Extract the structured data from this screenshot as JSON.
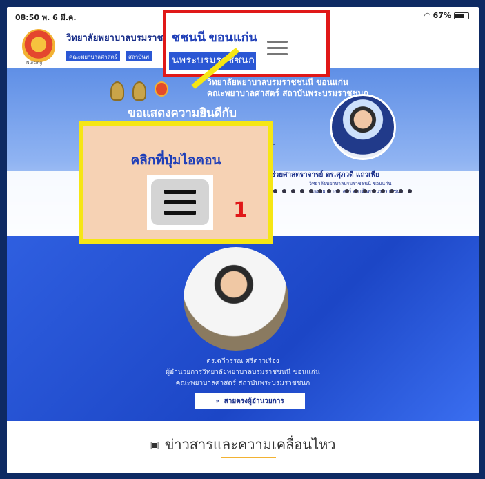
{
  "status_bar": {
    "time_date": "08:50  พ. 6 มี.ค.",
    "battery": "67%"
  },
  "header": {
    "site_title": "วิทยาลัยพยาบาลบรมราชช",
    "chip1": "คณะพยาบาลศาสตร์",
    "chip2": "สถาบันพ",
    "logo_sub": "Nursing"
  },
  "hero": {
    "line1": "วิทยาลัยพยาบาลบรมราชชนนี ขอนแก่น",
    "line2": "คณะพยาบาลศาสตร์ สถาบันพระบรมราชชนก",
    "congrats": "ขอแสดงความยินดีกับ",
    "unit": "ชนก",
    "prof_name": "ผู้ช่วยศาสตราจารย์ ดร.ศุภวดี แถวเพีย",
    "prof_sub1": "วิทยาลัยพยาบาลบรมราชชนนี ขอนแก่น",
    "prof_sub2": "คณะพยาบาลศาสตร์ สถาบันพระบรมราชชนก"
  },
  "director": {
    "name": "ดร.ฉวีวรรณ ศรีดาวเรือง",
    "title1": "ผู้อำนวยการวิทยาลัยพยาบาลบรมราชชนนี ขอนแก่น",
    "title2": "คณะพยาบาลศาสตร์ สถาบันพระบรมราชชนก",
    "button_icon": "»",
    "button_label": "สายตรงผู้อำนวยการ"
  },
  "news": {
    "icon": "▣",
    "title": "ข่าวสารและความเคลื่อนไหว"
  },
  "highlight": {
    "text1": "ชชนนี ขอนแก่น",
    "text2": "นพระบรมราชชนก"
  },
  "callout": {
    "instruction": "คลิกที่ปุ่มไอคอน",
    "step_number": "1"
  },
  "colors": {
    "accent_red": "#e01818",
    "callout_yellow": "#f6e614",
    "brand_blue": "#2b57d4"
  },
  "icons": [
    "menu-icon",
    "logo-icon",
    "battery-icon",
    "news-icon"
  ]
}
